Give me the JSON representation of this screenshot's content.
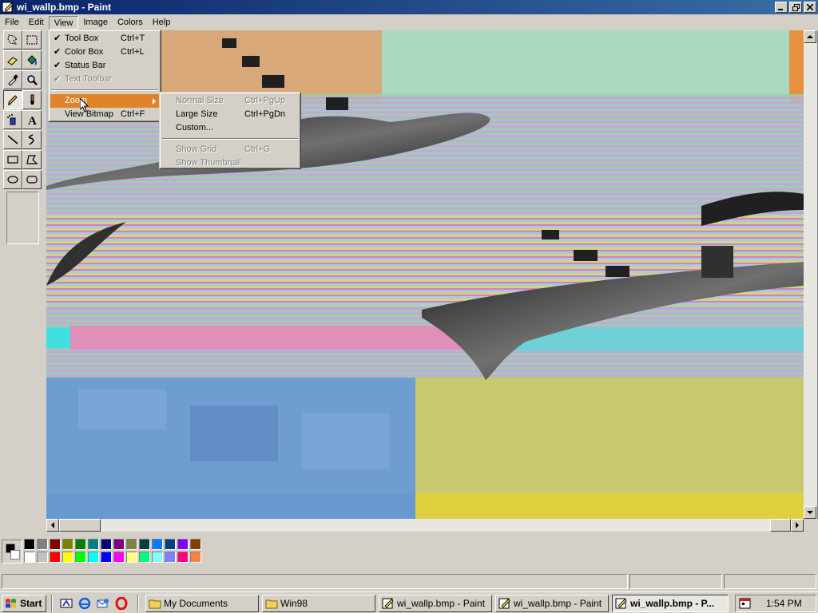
{
  "window": {
    "title": "wi_wallp.bmp - Paint"
  },
  "menubar": {
    "items": [
      "File",
      "Edit",
      "View",
      "Image",
      "Colors",
      "Help"
    ]
  },
  "view_menu": {
    "items": [
      {
        "label": "Tool Box",
        "accel": "Ctrl+T",
        "checked": true
      },
      {
        "label": "Color Box",
        "accel": "Ctrl+L",
        "checked": true
      },
      {
        "label": "Status Bar",
        "accel": "",
        "checked": true
      },
      {
        "label": "Text Toolbar",
        "accel": "",
        "checked": true,
        "disabled": true
      },
      {
        "label": "Zoom",
        "accel": "",
        "submenu": true,
        "highlight": true
      },
      {
        "label": "View Bitmap",
        "accel": "Ctrl+F"
      }
    ]
  },
  "zoom_menu": {
    "items": [
      {
        "label": "Normal Size",
        "accel": "Ctrl+PgUp",
        "disabled": true
      },
      {
        "label": "Large Size",
        "accel": "Ctrl+PgDn"
      },
      {
        "label": "Custom...",
        "accel": ""
      },
      {
        "label": "Show Grid",
        "accel": "Ctrl+G",
        "disabled": true
      },
      {
        "label": "Show Thumbnail",
        "accel": "",
        "disabled": true
      }
    ]
  },
  "toolbox": {
    "tools": [
      "free-form-select",
      "select",
      "eraser",
      "fill-with-color",
      "pick-color",
      "magnifier",
      "pencil",
      "brush",
      "airbrush",
      "text",
      "line",
      "curve",
      "rectangle",
      "polygon",
      "ellipse",
      "rounded-rectangle"
    ],
    "selected": "pencil"
  },
  "colors": {
    "foreground": "#000000",
    "background": "#ffffff",
    "palette": [
      "#000000",
      "#808080",
      "#800000",
      "#808000",
      "#008000",
      "#008080",
      "#000080",
      "#800080",
      "#808040",
      "#004040",
      "#0080ff",
      "#004080",
      "#8000ff",
      "#804000",
      "#ffffff",
      "#c0c0c0",
      "#ff0000",
      "#ffff00",
      "#00ff00",
      "#00ffff",
      "#0000ff",
      "#ff00ff",
      "#ffff80",
      "#00ff80",
      "#80ffff",
      "#8080ff",
      "#ff0080",
      "#ff8040"
    ]
  },
  "taskbar": {
    "start_label": "Start",
    "quick_launch": [
      "show-desktop-icon",
      "internet-explorer-icon",
      "outlook-express-icon",
      "opera-icon"
    ],
    "tasks": [
      {
        "label": "My Documents",
        "icon": "folder-icon"
      },
      {
        "label": "Win98",
        "icon": "folder-icon"
      },
      {
        "label": "wi_wallp.bmp - Paint",
        "icon": "paint-icon"
      },
      {
        "label": "wi_wallp.bmp - Paint",
        "icon": "paint-icon"
      },
      {
        "label": "wi_wallp.bmp - P...",
        "icon": "paint-icon",
        "active": true
      }
    ],
    "clock": "1:54 PM"
  }
}
